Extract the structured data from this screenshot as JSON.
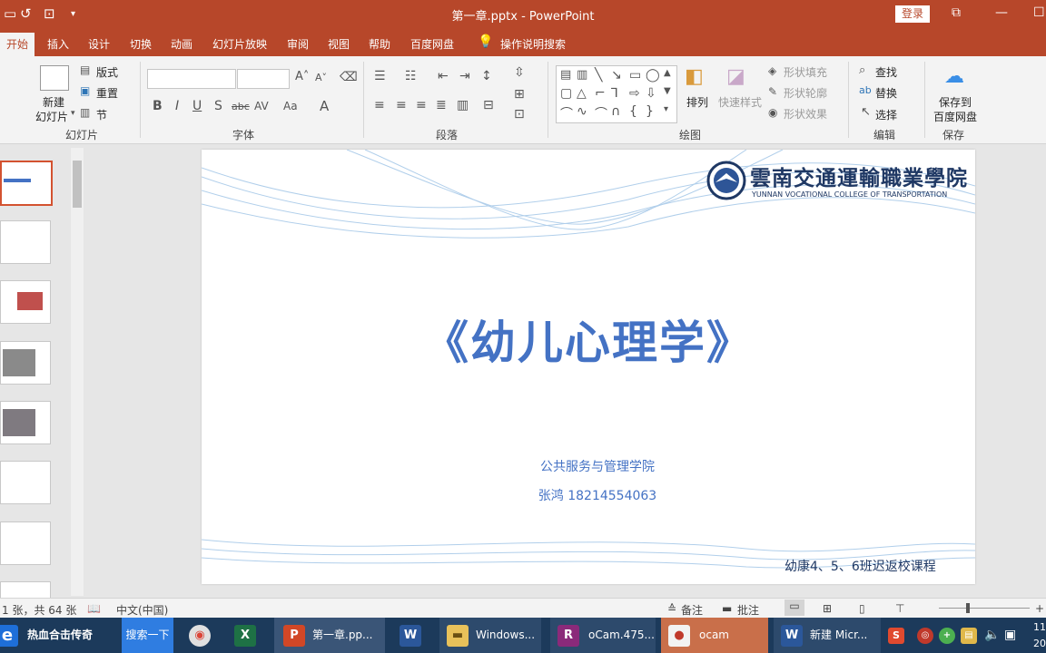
{
  "titlebar": {
    "title": "第一章.pptx  -  PowerPoint",
    "login": "登录",
    "restore": "⧉",
    "minimize": "—",
    "maximize": "☐"
  },
  "menu": {
    "tabs": [
      "开始",
      "插入",
      "设计",
      "切换",
      "动画",
      "幻灯片放映",
      "审阅",
      "视图",
      "帮助",
      "百度网盘"
    ],
    "tell_me": "操作说明搜索"
  },
  "ribbon": {
    "layout": "版式",
    "reset": "重置",
    "section": "节",
    "new_slide": "新建",
    "new_slide2": "幻灯片",
    "group_slides": "幻灯片",
    "group_font": "字体",
    "group_paragraph": "段落",
    "group_drawing": "绘图",
    "group_editing": "编辑",
    "group_save": "保存",
    "arrange": "排列",
    "quick_styles": "快速样式",
    "shape_fill": "形状填充",
    "shape_outline": "形状轮廓",
    "shape_effects": "形状效果",
    "find": "查找",
    "replace": "替换",
    "select": "选择",
    "save_baidu1": "保存到",
    "save_baidu2": "百度网盘"
  },
  "slide": {
    "title": "《幼儿心理学》",
    "department": "公共服务与管理学院",
    "author": "张鸿 18214554063",
    "footer": "幼康4、5、6班迟返校课程",
    "logo_cn": "雲南交通運輸職業學院",
    "logo_en": "YUNNAN VOCATIONAL COLLEGE OF TRANSPORTATION"
  },
  "status": {
    "slide_count": "1 张，共 64 张",
    "language": "中文(中国)",
    "notes": "备注",
    "comments": "批注"
  },
  "taskbar": {
    "game": "热血合击传奇",
    "search": "搜索一下",
    "ppt": "第一章.pp...",
    "explorer": "Windows...",
    "ocam_file": "oCam.475...",
    "ocam": "ocam",
    "word": "新建 Micr...",
    "clock1": "11",
    "clock2": "20"
  },
  "colors": {
    "accent": "#b7472a",
    "title_blue": "#4472c4"
  }
}
